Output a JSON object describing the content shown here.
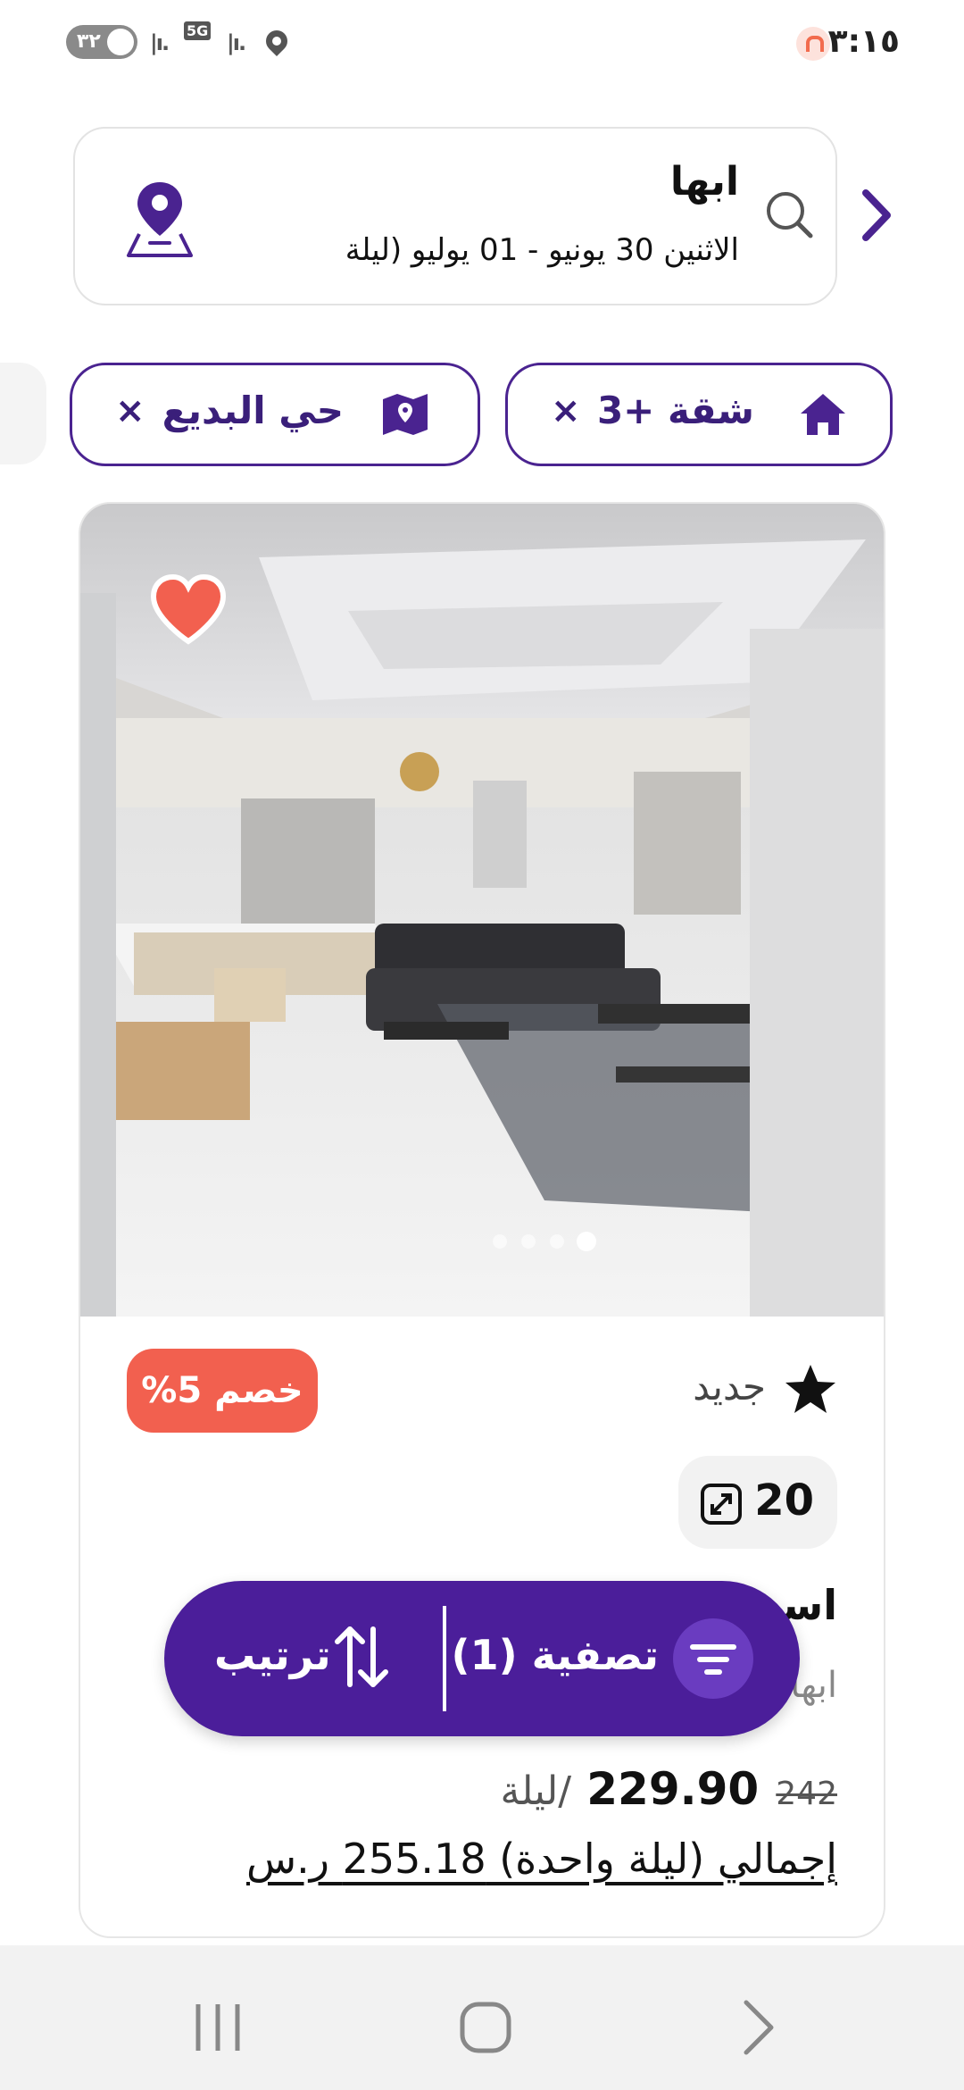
{
  "status_bar": {
    "time": "٣:١٥",
    "battery": "٣٢",
    "network": "5G"
  },
  "search": {
    "city": "ابها",
    "dates": "الاثنين 30 يونيو - 01 يوليو (ليلة"
  },
  "filters": {
    "chips": [
      {
        "label": "شقة +3",
        "icon": "home-icon",
        "remove": "×"
      },
      {
        "label": "حي البديع",
        "icon": "map-icon",
        "remove": "×"
      }
    ]
  },
  "listing": {
    "badge_new": "جديد",
    "discount": "خصم 5%",
    "area": "20",
    "title": "است...ية",
    "location": "ابها",
    "old_price": "242",
    "price": "229.90",
    "per_night": "/ليلة",
    "total": "إجمالي (ليلة واحدة) 255.18 ر.س",
    "photo_count": 4,
    "active_photo": 4,
    "favorited": true
  },
  "floating_bar": {
    "filter_label": "تصفية (1)",
    "sort_label": "ترتيب"
  },
  "colors": {
    "brand_purple": "#4b1e9a",
    "discount_red": "#f2604f",
    "heart_red": "#f2604f"
  }
}
